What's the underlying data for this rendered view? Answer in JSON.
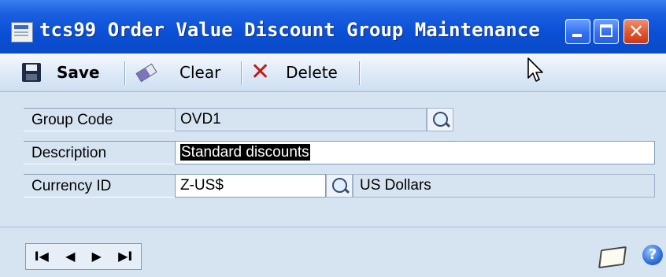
{
  "window": {
    "title": "tcs99 Order Value Discount Group Maintenance"
  },
  "toolbar": {
    "save_label": "Save",
    "clear_label": "Clear",
    "delete_label": "Delete"
  },
  "form": {
    "group_code_label": "Group Code",
    "group_code_value": "OVD1",
    "description_label": "Description",
    "description_value": "Standard discounts",
    "currency_id_label": "Currency ID",
    "currency_id_value": "Z-US$",
    "currency_name": "US Dollars"
  },
  "navigation": {
    "first": "I◀",
    "previous": "◀",
    "next": "▶",
    "last": "▶I"
  },
  "help_glyph": "?",
  "colors": {
    "titlebar": "#0a4fd6",
    "close_button": "#e0502a",
    "form_background": "#d6e4f2"
  },
  "icons": [
    "app-icon",
    "save-icon",
    "eraser-icon",
    "delete-x-icon",
    "lookup-icon",
    "note-icon",
    "help-icon"
  ]
}
